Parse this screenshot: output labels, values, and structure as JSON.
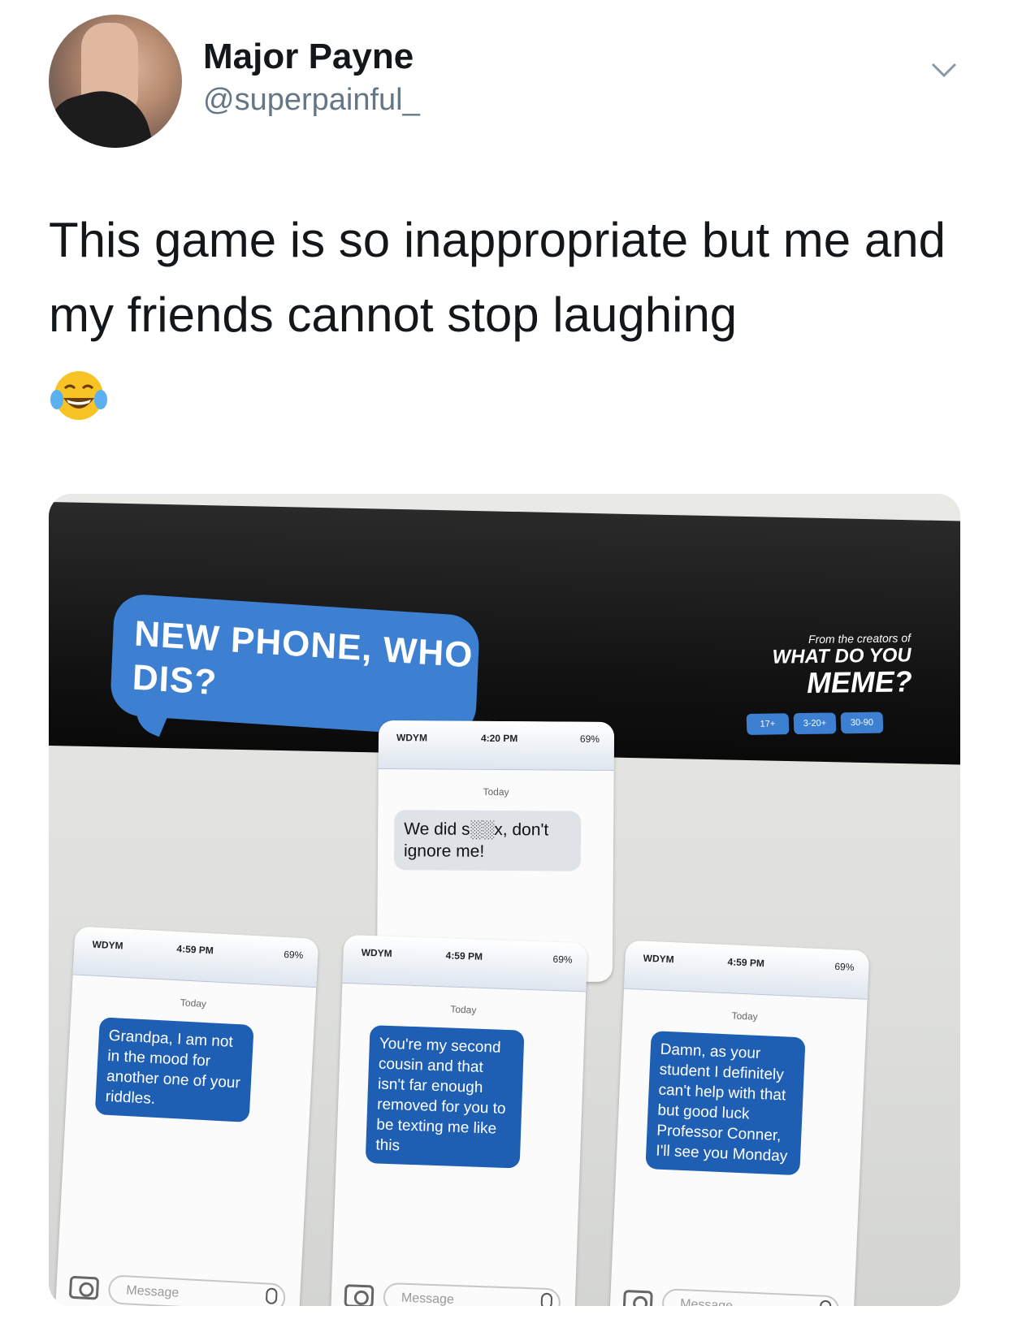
{
  "tweet": {
    "display_name": "Major Payne",
    "handle": "@superpainful_",
    "text": "This game is so inappropriate but me and my friends cannot stop laughing",
    "emoji": "😂"
  },
  "photo": {
    "box_title": "NEW PHONE, WHO DIS?",
    "box_small": "From the creators of",
    "box_brand_1": "WHAT DO YOU",
    "box_brand_2": "MEME?",
    "box_icons": [
      "17+",
      "3-20+",
      "30-90"
    ],
    "cards": [
      {
        "carrier": "WDYM",
        "time": "4:20 PM",
        "battery": "69%",
        "today": "Today",
        "message": "We did s░░x, don't ignore me!"
      },
      {
        "carrier": "WDYM",
        "time": "4:59 PM",
        "battery": "69%",
        "today": "Today",
        "message": "Grandpa, I am not in the mood for another one of your riddles.",
        "composer": "Message"
      },
      {
        "carrier": "WDYM",
        "time": "4:59 PM",
        "battery": "69%",
        "today": "Today",
        "message": "You're my second cousin and that isn't far enough removed for you to be texting me like this",
        "composer": "Message"
      },
      {
        "carrier": "WDYM",
        "time": "4:59 PM",
        "battery": "69%",
        "today": "Today",
        "message": "Damn, as your student I definitely can't help with that but good luck Professor Conner, I'll see you Monday",
        "composer": "Message"
      }
    ]
  },
  "colors": {
    "bubble_blue": "#1f5fb3",
    "box_blue": "#3d7fd0",
    "handle_grey": "#657786"
  },
  "icons": {
    "chevron": "chevron-down-icon",
    "camera": "camera-icon",
    "mic": "mic-icon"
  }
}
